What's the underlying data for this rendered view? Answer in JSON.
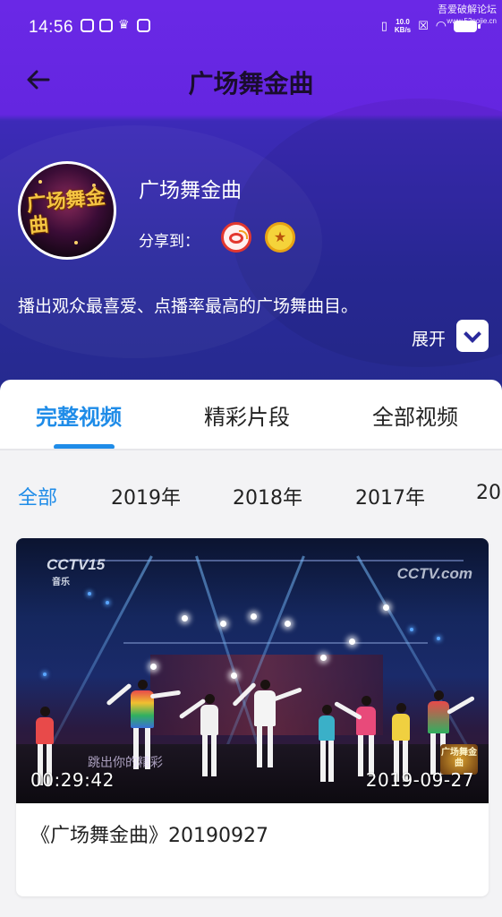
{
  "status_bar": {
    "time": "14:56",
    "net_speed_value": "10.0",
    "net_speed_unit": "KB/s",
    "watermark_line1": "吾爱破解论坛",
    "watermark_line2": "www.52pojie.cn"
  },
  "nav": {
    "back_icon": "arrow-left-icon",
    "title": "广场舞金曲"
  },
  "program": {
    "logo_text": "广场舞金曲",
    "name": "广场舞金曲",
    "share_label": "分享到：",
    "share_targets": [
      "weibo-icon",
      "favorite-star-icon"
    ],
    "description": "播出观众最喜爱、点播率最高的广场舞曲目。",
    "expand_label": "展开"
  },
  "tabs": [
    {
      "label": "完整视频",
      "active": true
    },
    {
      "label": "精彩片段",
      "active": false
    },
    {
      "label": "全部视频",
      "active": false
    }
  ],
  "year_filters": [
    {
      "label": "全部",
      "active": true
    },
    {
      "label": "2019年",
      "active": false
    },
    {
      "label": "2018年",
      "active": false
    },
    {
      "label": "2017年",
      "active": false
    },
    {
      "label": "20",
      "active": false
    }
  ],
  "videos": [
    {
      "channel_logo": "CCTV15",
      "channel_sub": "音乐",
      "channel_logo_right": "CCTV.com",
      "overlay_caption": "跳出你的精彩",
      "corner_logo": "广场舞金曲",
      "duration": "00:29:42",
      "date": "2019-09-27",
      "title": "《广场舞金曲》20190927"
    }
  ],
  "colors": {
    "accent": "#1f8ce8",
    "header_purple": "#6426e0",
    "hero_navy": "#2a2a9c"
  }
}
